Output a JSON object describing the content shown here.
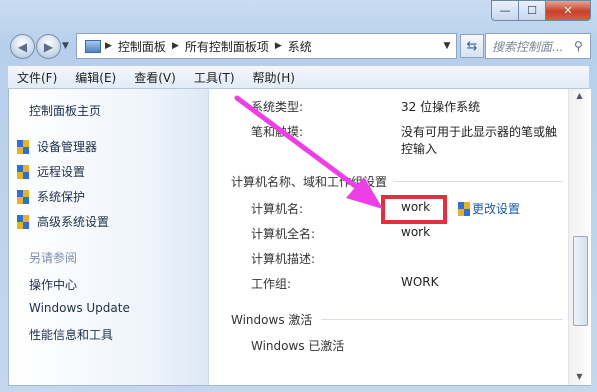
{
  "caption": {
    "min": "—",
    "max": "☐",
    "close": "✕"
  },
  "nav": {
    "breadcrumb": [
      "控制面板",
      "所有控制面板项",
      "系统"
    ],
    "search_placeholder": "搜索控制面...",
    "back_icon": "back-arrow",
    "forward_icon": "forward-arrow"
  },
  "menu": [
    "文件(F)",
    "编辑(E)",
    "查看(V)",
    "工具(T)",
    "帮助(H)"
  ],
  "sidebar": {
    "home": "控制面板主页",
    "tasks": [
      "设备管理器",
      "远程设置",
      "系统保护",
      "高级系统设置"
    ],
    "see_also": "另请参阅",
    "related": [
      "操作中心",
      "Windows Update",
      "性能信息和工具"
    ]
  },
  "system": {
    "type_label": "系统类型:",
    "type_value": "32 位操作系统",
    "pen_label": "笔和触摸:",
    "pen_value_1": "没有可用于此显示器的笔或触",
    "pen_value_2": "控输入"
  },
  "computer": {
    "section": "计算机名称、域和工作组设置",
    "name_label": "计算机名:",
    "name_value": "work",
    "change_link": "更改设置",
    "fullname_label": "计算机全名:",
    "fullname_value": "work",
    "desc_label": "计算机描述:",
    "workgroup_label": "工作组:",
    "workgroup_value": "WORK"
  },
  "activation": {
    "section": "Windows 激活",
    "status": "Windows 已激活"
  },
  "annotation_colors": {
    "arrow": "#ee3fe6",
    "highlight_box": "#e0303f"
  }
}
